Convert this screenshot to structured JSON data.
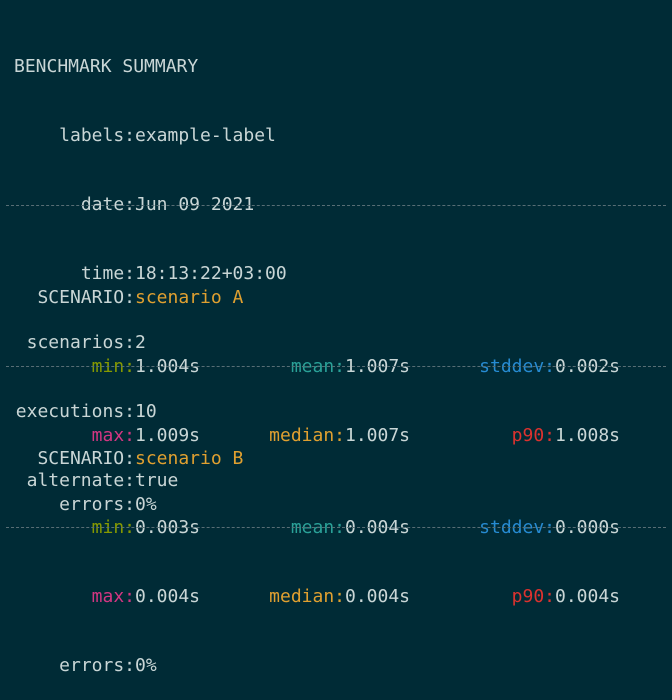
{
  "summary": {
    "title": "BENCHMARK SUMMARY",
    "labels_key": "labels:",
    "labels_val": "example-label",
    "date_key": "date:",
    "date_val": "Jun 09 2021",
    "time_key": "time:",
    "time_val": "18:13:22+03:00",
    "scenarios_key": "scenarios:",
    "scenarios_val": "2",
    "executions_key": "executions:",
    "executions_val": "10",
    "alternate_key": "alternate:",
    "alternate_val": "true"
  },
  "separator": "----------------------------------------------------------------------------------",
  "scenarios": [
    {
      "scenario_key": "SCENARIO:",
      "name": "scenario A",
      "min_key": "min:",
      "min_val": "1.004s",
      "mean_key": "mean:",
      "mean_val": "1.007s",
      "stddev_key": "stddev:",
      "stddev_val": "0.002s",
      "max_key": "max:",
      "max_val": "1.009s",
      "median_key": "median:",
      "median_val": "1.007s",
      "p90_key": "p90:",
      "p90_val": "1.008s",
      "errors_key": "errors:",
      "errors_val": "0%"
    },
    {
      "scenario_key": "SCENARIO:",
      "name": "scenario B",
      "min_key": "min:",
      "min_val": "0.003s",
      "mean_key": "mean:",
      "mean_val": "0.004s",
      "stddev_key": "stddev:",
      "stddev_val": "0.000s",
      "max_key": "max:",
      "max_val": "0.004s",
      "median_key": "median:",
      "median_val": "0.004s",
      "p90_key": "p90:",
      "p90_val": "0.004s",
      "errors_key": "errors:",
      "errors_val": "0%"
    }
  ],
  "colors": {
    "background": "#002b36",
    "text": "#c9d6d6",
    "scenario_name": "#e0a030",
    "min": "#859900",
    "mean": "#2aa198",
    "stddev": "#268bd2",
    "max": "#d33682",
    "median": "#e0a030",
    "p90": "#dc322f",
    "separator": "#586e75"
  }
}
